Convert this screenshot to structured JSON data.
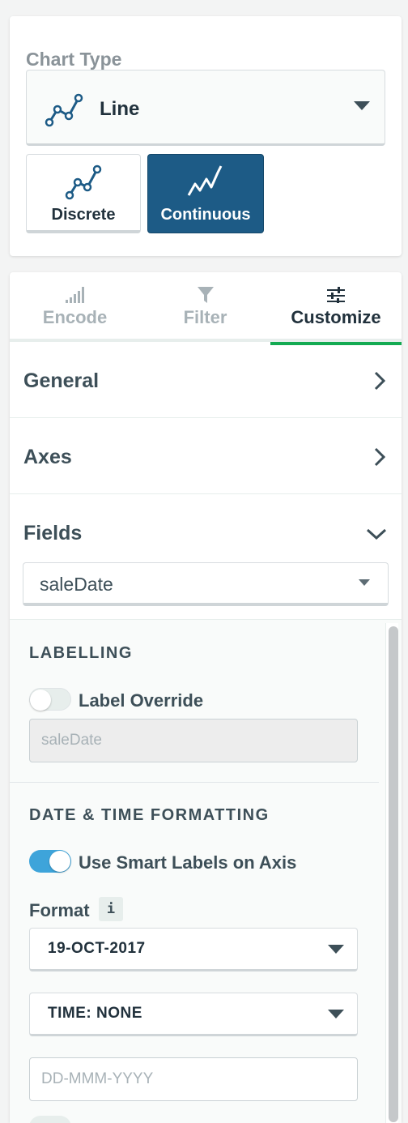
{
  "chart_type": {
    "heading": "Chart Type",
    "selected": "Line",
    "selected_icon": "line-chart-icon",
    "subtypes": [
      {
        "label": "Discrete",
        "icon": "discrete-line-icon",
        "active": false
      },
      {
        "label": "Continuous",
        "icon": "continuous-line-icon",
        "active": true
      }
    ]
  },
  "tabs": [
    {
      "label": "Encode",
      "icon": "signal-bars-icon",
      "active": false
    },
    {
      "label": "Filter",
      "icon": "funnel-icon",
      "active": false
    },
    {
      "label": "Customize",
      "icon": "sliders-icon",
      "active": true
    }
  ],
  "sections": [
    {
      "title": "General",
      "expanded": false
    },
    {
      "title": "Axes",
      "expanded": false
    },
    {
      "title": "Fields",
      "expanded": true
    }
  ],
  "field_select": {
    "value": "saleDate"
  },
  "labelling": {
    "heading": "LABELLING",
    "toggle_label": "Label Override",
    "toggle_on": false,
    "input_placeholder": "saleDate"
  },
  "date_time": {
    "heading": "DATE & TIME FORMATTING",
    "smart_labels": "Use Smart Labels on Axis",
    "smart_labels_on": true,
    "format_label": "Format",
    "info_glyph": "i",
    "date_format": "19-OCT-2017",
    "time_format": "TIME: NONE",
    "custom_placeholder": "DD-MMM-YYYY"
  },
  "colors": {
    "accent_blue": "#1d5b86",
    "toggle_on": "#3ea4da",
    "active_tab": "#13aa52"
  }
}
